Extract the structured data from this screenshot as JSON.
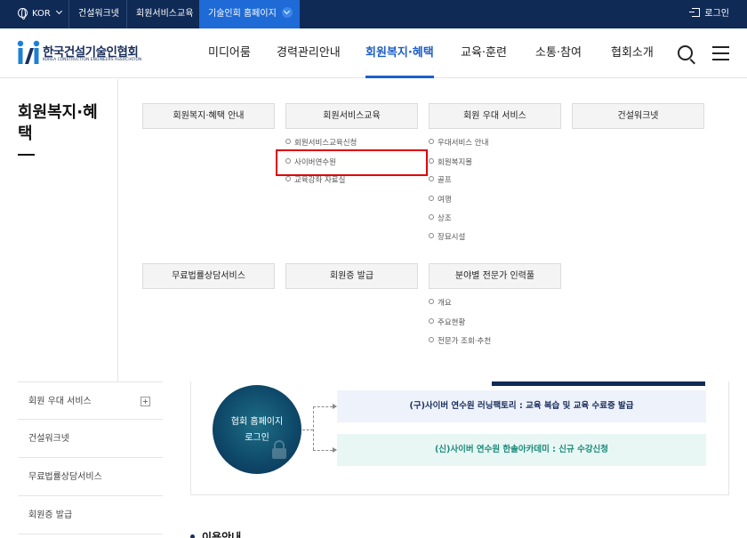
{
  "topbar": {
    "lang": "KOR",
    "sites": [
      "건설워크넷",
      "회원서비스교육",
      "기술인회 홈페이지"
    ],
    "login": "로그인"
  },
  "header": {
    "logo_text": "한국건설기술인협회",
    "logo_sub": "KOREA CONSTRUCTION ENGINEERS ASSOCIATION",
    "nav": [
      "미디어룸",
      "경력관리안내",
      "회원복지·혜택",
      "교육·훈련",
      "소통·참여",
      "협회소개"
    ]
  },
  "mega": {
    "title": "회원복지·혜택",
    "groups": [
      {
        "label": "회원복지·혜택 안내",
        "items": []
      },
      {
        "label": "회원서비스교육",
        "items": [
          "회원서비스교육신청",
          "사이버연수원",
          "교육강좌 자료실"
        ]
      },
      {
        "label": "회원 우대 서비스",
        "items": [
          "우대서비스 안내",
          "회원복지몰",
          "골프",
          "여행",
          "상조",
          "장묘시설"
        ]
      },
      {
        "label": "건설워크넷",
        "items": []
      },
      {
        "label": "무료법률상담서비스",
        "items": []
      },
      {
        "label": "회원증 발급",
        "items": []
      },
      {
        "label": "분야별 전문가 인력풀",
        "items": [
          "개요",
          "주요현황",
          "전문가 조회·추천"
        ]
      }
    ]
  },
  "sidenav": [
    "회원 우대 서비스",
    "건설워크넷",
    "무료법률상담서비스",
    "회원증 발급"
  ],
  "content": {
    "circle_line1": "협회 홈페이지",
    "circle_line2": "로그인",
    "btn_old": "(구)사이버 연수원 러닝팩토리 : 교육 복습 및 교육 수료증 발급",
    "btn_new": "(신)사이버 연수원 한솔아카데미 : 신규 수강신청",
    "usage_title": "이용안내"
  }
}
